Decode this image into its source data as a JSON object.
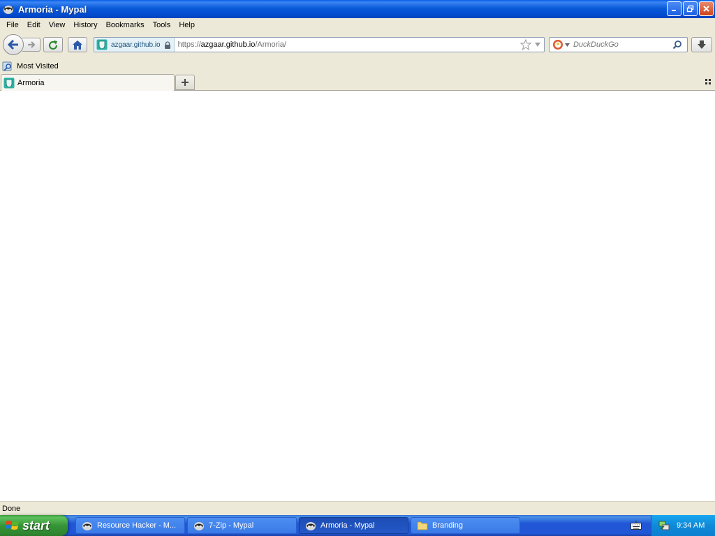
{
  "window": {
    "title": "Armoria - Mypal"
  },
  "menu": {
    "items": [
      "File",
      "Edit",
      "View",
      "History",
      "Bookmarks",
      "Tools",
      "Help"
    ]
  },
  "navbar": {
    "identity_host": "azgaar.github.io",
    "url_scheme": "https://",
    "url_host": "azgaar.github.io",
    "url_path": "/Armoria/",
    "search_placeholder": "DuckDuckGo"
  },
  "bookmarks": {
    "items": [
      {
        "label": "Most Visited"
      }
    ]
  },
  "tabs": [
    {
      "label": "Armoria",
      "active": true
    }
  ],
  "statusbar": {
    "text": "Done"
  },
  "taskbar": {
    "start_label": "start",
    "items": [
      {
        "label": "Resource Hacker - M...",
        "active": false
      },
      {
        "label": "7-Zip - Mypal",
        "active": false
      },
      {
        "label": "Armoria - Mypal",
        "active": true
      },
      {
        "label": "Branding",
        "active": false
      }
    ],
    "clock": "9:34 AM"
  },
  "colors": {
    "titlebar": "#0450d4",
    "chrome": "#ece9d8",
    "content_bg": "#ffffff",
    "taskbar": "#2157d7",
    "start_button": "#379437",
    "tray": "#0f8ad8"
  }
}
